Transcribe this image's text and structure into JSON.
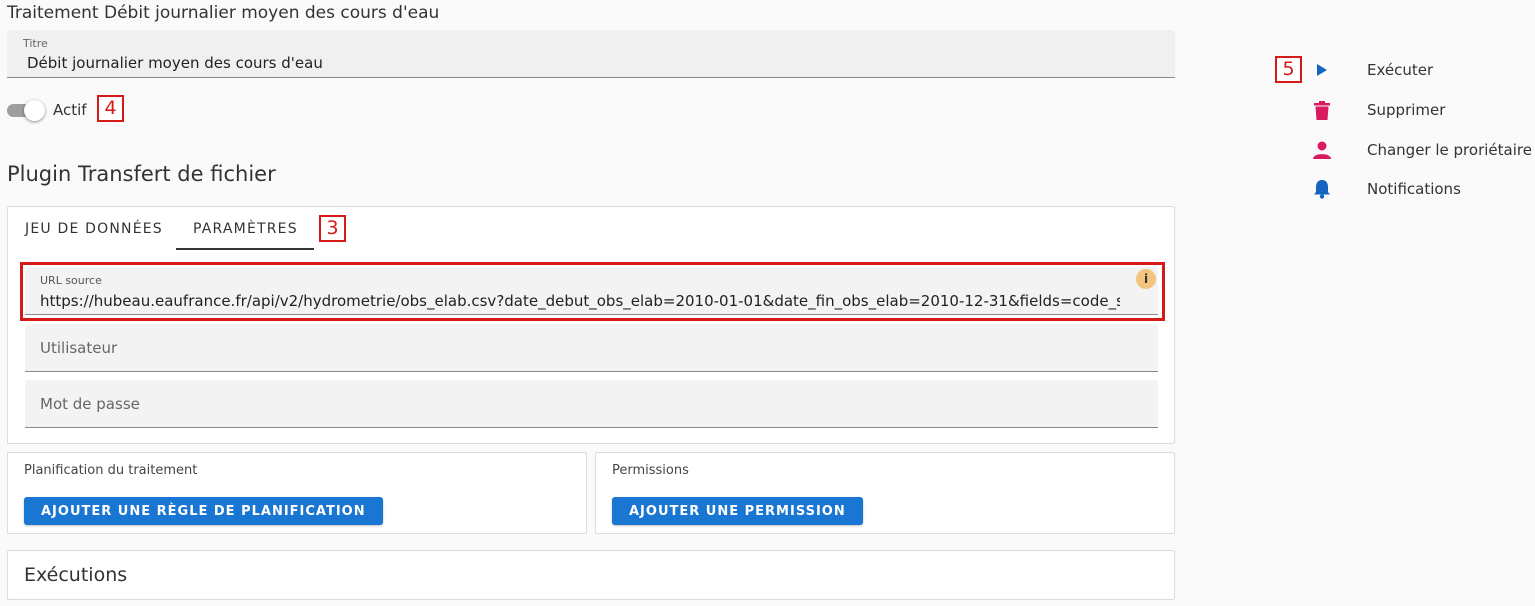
{
  "page": {
    "title": "Traitement Débit journalier moyen des cours d'eau"
  },
  "title_field": {
    "label": "Titre",
    "value": "Débit journalier moyen des cours d'eau"
  },
  "toggle": {
    "label": "Actif",
    "state": "on"
  },
  "plugin": {
    "title": "Plugin Transfert de fichier",
    "tabs": [
      {
        "label": "JEU DE DONNÉES",
        "active": false
      },
      {
        "label": "PARAMÈTRES",
        "active": true
      }
    ],
    "fields": {
      "url": {
        "label": "URL source",
        "value": "https://hubeau.eaufrance.fr/api/v2/hydrometrie/obs_elab.csv?date_debut_obs_elab=2010-01-01&date_fin_obs_elab=2010-12-31&fields=code_stati"
      },
      "user": {
        "placeholder": "Utilisateur"
      },
      "password": {
        "placeholder": "Mot de passe"
      }
    }
  },
  "scheduling": {
    "label": "Planification du traitement",
    "button": "AJOUTER UNE RÈGLE DE PLANIFICATION"
  },
  "permissions": {
    "label": "Permissions",
    "button": "AJOUTER UNE PERMISSION"
  },
  "executions": {
    "title": "Exécutions"
  },
  "actions": [
    {
      "label": "Exécuter",
      "icon": "play-icon",
      "color": "#1565c0"
    },
    {
      "label": "Supprimer",
      "icon": "trash-icon",
      "color": "#d81b60"
    },
    {
      "label": "Changer le proriétaire",
      "icon": "person-icon",
      "color": "#d81b60"
    },
    {
      "label": "Notifications",
      "icon": "bell-icon",
      "color": "#1565c0"
    }
  ],
  "annotations": {
    "badge_3": "3",
    "badge_4": "4",
    "badge_5": "5"
  },
  "colors": {
    "primary": "#1976d2",
    "highlight": "#d61a1a",
    "info": "#f3c47e"
  }
}
